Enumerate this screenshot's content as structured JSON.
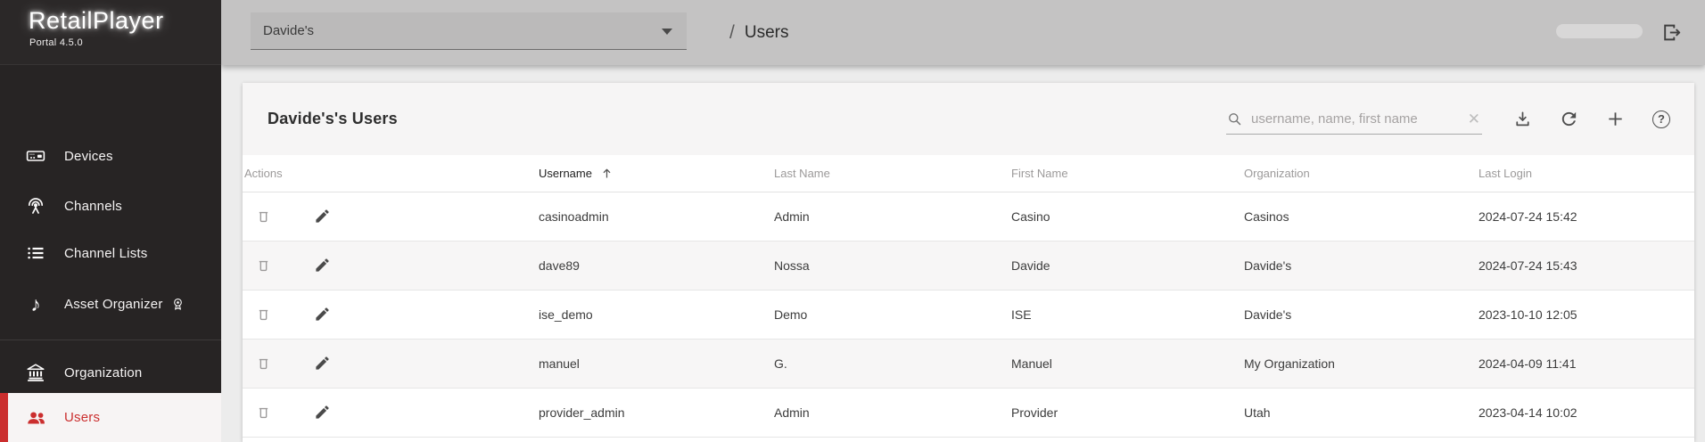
{
  "colors": {
    "accent_red": "#cb2e2e",
    "sidebar_bg": "#272424",
    "topbar_bg": "#c4c3c3",
    "card_toolbar_bg": "#f6f5f5",
    "row_stripe": "#f7f6f6"
  },
  "logo": {
    "title": "RetailPlayer",
    "subtitle": "Portal 4.5.0"
  },
  "header": {
    "org_selector_value": "Davide's",
    "breadcrumb_separator": "/",
    "breadcrumb_current": "Users"
  },
  "sidebar": {
    "items": [
      {
        "label": "Devices",
        "icon": "devices-icon"
      },
      {
        "label": "Channels",
        "icon": "broadcast-icon"
      },
      {
        "label": "Channel Lists",
        "icon": "list-icon"
      },
      {
        "label": "Asset Organizer",
        "icon": "music-note-icon",
        "badge": "premium-badge-icon"
      },
      {
        "label": "Organization",
        "icon": "bank-icon"
      },
      {
        "label": "Users",
        "icon": "users-icon",
        "active": true
      }
    ]
  },
  "toolbar": {
    "title": "Davide's's Users",
    "search_placeholder": "username, name, first name"
  },
  "icons": {
    "music_note": "♪",
    "clear": "✕",
    "help": "?"
  },
  "table": {
    "columns": [
      {
        "label": "Actions"
      },
      {
        "label": "Username",
        "sorted": "asc"
      },
      {
        "label": "Last Name"
      },
      {
        "label": "First Name"
      },
      {
        "label": "Organization"
      },
      {
        "label": "Last Login"
      }
    ],
    "rows": [
      {
        "username": "casinoadmin",
        "last_name": "Admin",
        "first_name": "Casino",
        "organization": "Casinos",
        "last_login": "2024-07-24 15:42"
      },
      {
        "username": "dave89",
        "last_name": "Nossa",
        "first_name": "Davide",
        "organization": "Davide's",
        "last_login": "2024-07-24 15:43"
      },
      {
        "username": "ise_demo",
        "last_name": "Demo",
        "first_name": "ISE",
        "organization": "Davide's",
        "last_login": "2023-10-10 12:05"
      },
      {
        "username": "manuel",
        "last_name": "G.",
        "first_name": "Manuel",
        "organization": "My Organization",
        "last_login": "2024-04-09 11:41"
      },
      {
        "username": "provider_admin",
        "last_name": "Admin",
        "first_name": "Provider",
        "organization": "Utah",
        "last_login": "2023-04-14 10:02"
      }
    ]
  }
}
